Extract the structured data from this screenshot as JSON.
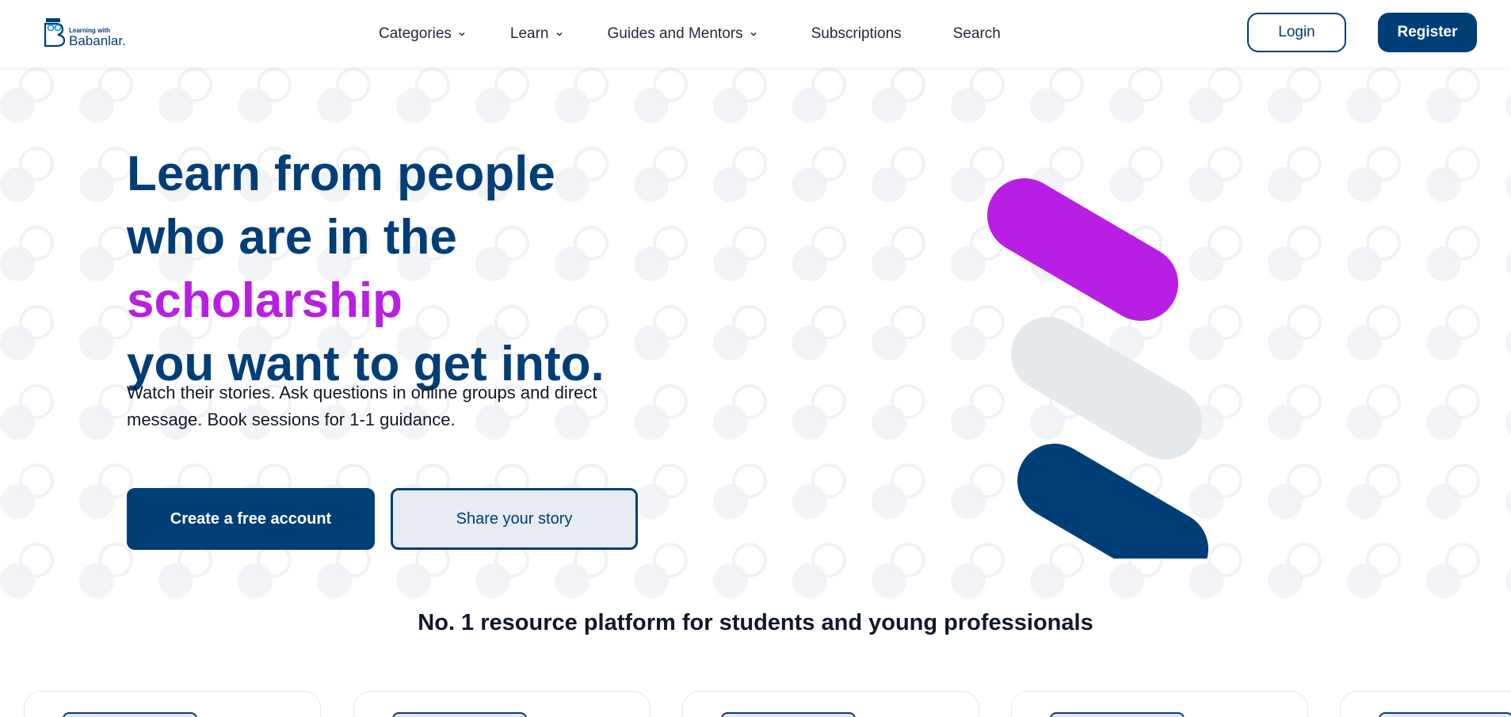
{
  "brand": {
    "small_text": "Learning with",
    "main_text": "Babanlar.",
    "primary_color": "#003e77",
    "accent_color": "#b91ee4"
  },
  "nav": {
    "items": [
      {
        "label": "Categories",
        "has_dropdown": true
      },
      {
        "label": "Learn",
        "has_dropdown": true
      },
      {
        "label": "Guides and Mentors",
        "has_dropdown": true
      },
      {
        "label": "Subscriptions",
        "has_dropdown": false
      },
      {
        "label": "Search",
        "has_dropdown": false
      }
    ]
  },
  "auth": {
    "login_label": "Login",
    "register_label": "Register"
  },
  "hero": {
    "headline_line1": "Learn from people",
    "headline_line2_prefix": "who are in the ",
    "headline_accent": "scholarship",
    "headline_line3": "you want to get into.",
    "subtext": "Watch their stories. Ask questions in online groups and direct message. Book sessions for 1-1 guidance.",
    "cta_primary": "Create a free account",
    "cta_secondary": "Share your story",
    "pill_colors": [
      "#b91ee4",
      "#e4e9ee",
      "#003e77"
    ]
  },
  "tagline": "No. 1 resource platform for students and young professionals",
  "cards": [
    {},
    {},
    {},
    {},
    {}
  ]
}
